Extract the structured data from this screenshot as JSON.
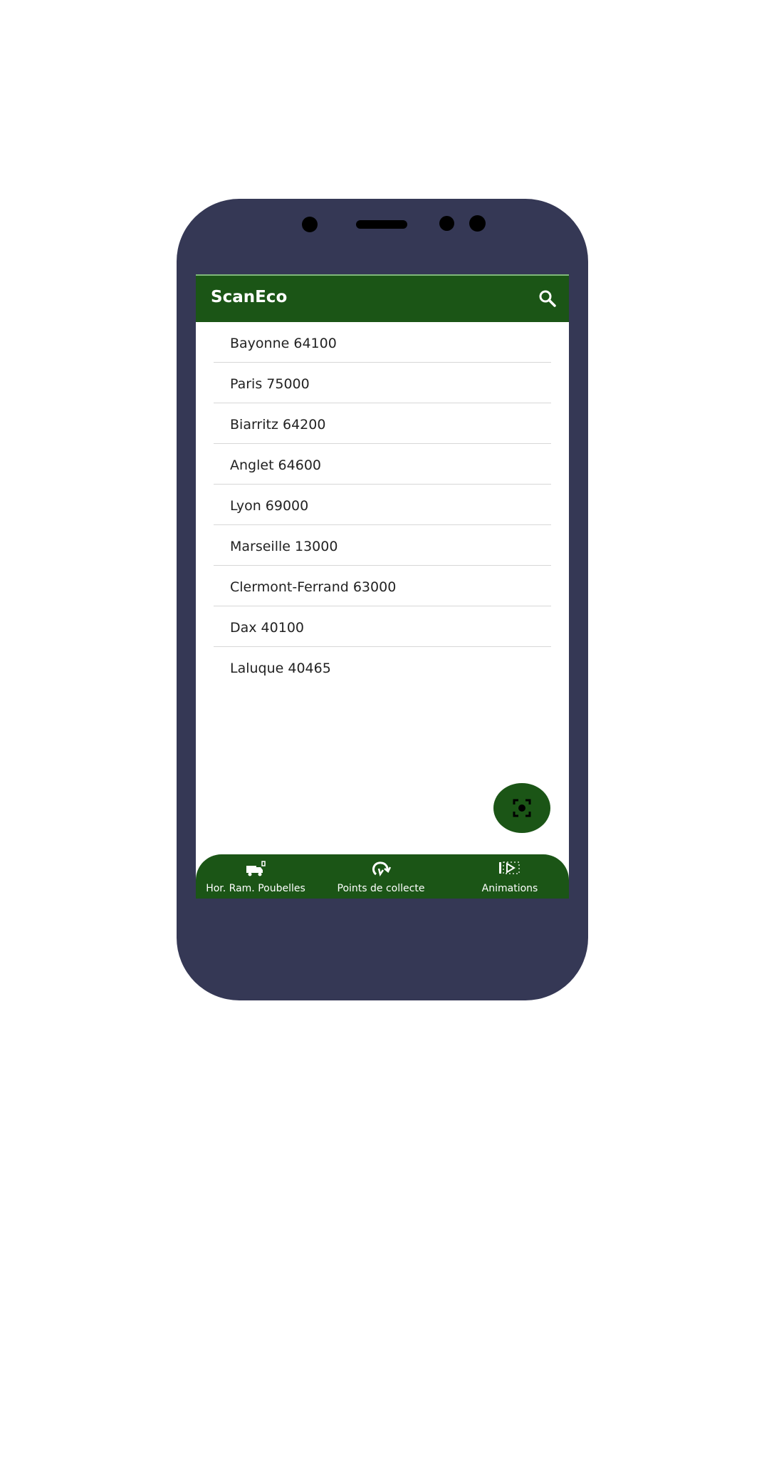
{
  "app": {
    "title": "ScanEco"
  },
  "toolbar": {
    "search_icon": "search-icon"
  },
  "cities": [
    {
      "label": "Bayonne 64100"
    },
    {
      "label": "Paris 75000"
    },
    {
      "label": "Biarritz 64200"
    },
    {
      "label": "Anglet 64600"
    },
    {
      "label": "Lyon 69000"
    },
    {
      "label": "Marseille 13000"
    },
    {
      "label": "Clermont-Ferrand 63000"
    },
    {
      "label": "Dax 40100"
    },
    {
      "label": "Laluque 40465"
    }
  ],
  "fab": {
    "icon": "scan-icon"
  },
  "bottom_nav": [
    {
      "label": "Hor. Ram. Poubelles",
      "icon": "truck-icon"
    },
    {
      "label": "Points de collecte",
      "icon": "recycle-icon"
    },
    {
      "label": "Animations",
      "icon": "slides-icon"
    }
  ],
  "colors": {
    "primary": "#1b5516",
    "phone_body": "#353855"
  }
}
